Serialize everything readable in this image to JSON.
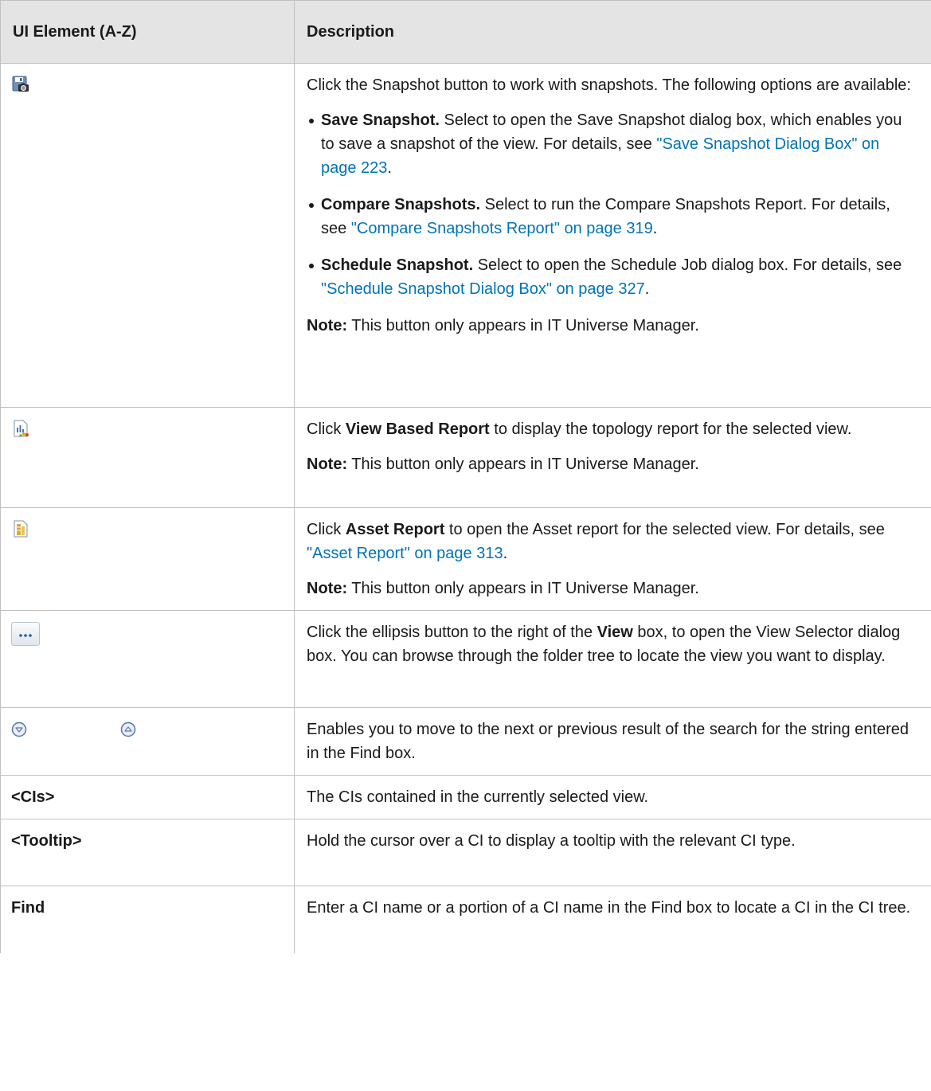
{
  "header": {
    "col1": "UI Element (A-Z)",
    "col2": "Description"
  },
  "rows": {
    "snapshot": {
      "icon": "snapshot-icon",
      "intro": "Click the Snapshot button to work with snapshots. The following options are available:",
      "options": [
        {
          "bold": "Save Snapshot.",
          "text": " Select to open the Save Snapshot dialog box, which enables you to save a snapshot of the view. For details, see ",
          "link": "\"Save Snapshot Dialog Box\" on page 223",
          "after": "."
        },
        {
          "bold": "Compare Snapshots.",
          "text": " Select to run the Compare Snapshots Report. For details, see ",
          "link": "\"Compare Snapshots Report\" on page 319",
          "after": "."
        },
        {
          "bold": "Schedule Snapshot.",
          "text": " Select to open the Schedule Job dialog box. For details, see ",
          "link": "\"Schedule Snapshot Dialog Box\" on page 327",
          "after": "."
        }
      ],
      "note_label": "Note:",
      "note_text": " This button only appears in IT Universe Manager."
    },
    "view_report": {
      "icon": "view-based-report-icon",
      "pre": "Click ",
      "bold": "View Based Report",
      "post": " to display the topology report for the selected view.",
      "note_label": "Note:",
      "note_text": " This button only appears in IT Universe Manager."
    },
    "asset_report": {
      "icon": "asset-report-icon",
      "pre": "Click ",
      "bold": "Asset Report",
      "post": " to open the Asset report for the selected view. For details, see ",
      "link": "\"Asset Report\" on page 313",
      "after": ".",
      "note_label": "Note:",
      "note_text": " This button only appears in IT Universe Manager."
    },
    "ellipsis": {
      "icon": "ellipsis-icon",
      "pre": "Click the ellipsis button to the right of the ",
      "bold": "View",
      "post": " box, to open the View Selector dialog box. You can browse through the folder tree to locate the view you want to display."
    },
    "nav": {
      "icons": [
        "next-result-icon",
        "previous-result-icon"
      ],
      "text": "Enables you to move to the next or previous result of the search for the string entered in the Find box."
    },
    "cis": {
      "element": "<CIs>",
      "text": "The CIs contained in the currently selected view."
    },
    "tooltip": {
      "element": "<Tooltip>",
      "text": "Hold the cursor over a CI to display a tooltip with the relevant CI type."
    },
    "find": {
      "element": "Find",
      "text": "Enter a CI name or a portion of a CI name in the Find box to locate a CI in the CI tree."
    }
  }
}
